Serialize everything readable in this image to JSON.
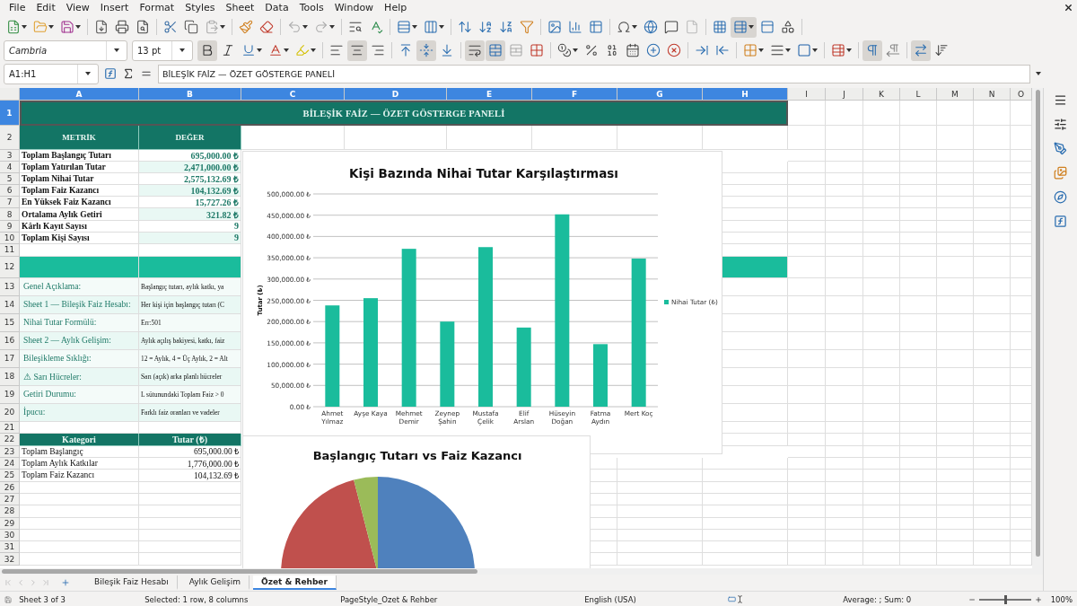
{
  "menu": [
    "File",
    "Edit",
    "View",
    "Insert",
    "Format",
    "Styles",
    "Sheet",
    "Data",
    "Tools",
    "Window",
    "Help"
  ],
  "standard_toolbar": [
    {
      "kind": "new",
      "dropdown": true,
      "on": false
    },
    {
      "kind": "open",
      "dropdown": true,
      "on": false
    },
    {
      "kind": "save",
      "dropdown": true,
      "on": false
    },
    {
      "kind": "pdf",
      "dropdown": false,
      "on": false
    },
    {
      "kind": "print",
      "dropdown": false,
      "on": false
    },
    {
      "kind": "preview",
      "dropdown": false,
      "on": false
    },
    {
      "kind": "cut",
      "dropdown": false,
      "on": false
    },
    {
      "kind": "copy",
      "dropdown": false,
      "on": false
    },
    {
      "kind": "paste",
      "dropdown": true,
      "on": false
    },
    {
      "kind": "clone",
      "dropdown": false,
      "on": false
    },
    {
      "kind": "clear",
      "dropdown": false,
      "on": false
    },
    {
      "kind": "undo",
      "dropdown": true,
      "on": false
    },
    {
      "kind": "redo",
      "dropdown": true,
      "on": false
    },
    {
      "kind": "find",
      "dropdown": false,
      "on": false
    },
    {
      "kind": "spelling",
      "dropdown": false,
      "on": false
    },
    {
      "kind": "row",
      "dropdown": true,
      "on": false
    },
    {
      "kind": "column",
      "dropdown": true,
      "on": false
    },
    {
      "kind": "sort",
      "dropdown": false,
      "on": false
    },
    {
      "kind": "sortasc",
      "dropdown": false,
      "on": false
    },
    {
      "kind": "sortdesc",
      "dropdown": false,
      "on": false
    },
    {
      "kind": "filter",
      "dropdown": false,
      "on": false
    },
    {
      "kind": "image",
      "dropdown": false,
      "on": false
    },
    {
      "kind": "chart",
      "dropdown": false,
      "on": false
    },
    {
      "kind": "pivot",
      "dropdown": false,
      "on": false
    },
    {
      "kind": "special",
      "dropdown": true,
      "on": false
    },
    {
      "kind": "link",
      "dropdown": false,
      "on": false
    },
    {
      "kind": "comment",
      "dropdown": false,
      "on": false
    },
    {
      "kind": "header",
      "dropdown": false,
      "on": false
    },
    {
      "kind": "printarea",
      "dropdown": false,
      "on": false
    },
    {
      "kind": "freeze",
      "dropdown": true,
      "on": true
    },
    {
      "kind": "split",
      "dropdown": false,
      "on": false
    },
    {
      "kind": "draw",
      "dropdown": false,
      "on": false
    }
  ],
  "formatting_toolbar": {
    "font_name": "Cambria",
    "font_size": "13 pt",
    "buttons": [
      {
        "kind": "bold",
        "dropdown": false,
        "on": true
      },
      {
        "kind": "italic",
        "dropdown": false,
        "on": false
      },
      {
        "kind": "underline",
        "dropdown": true,
        "on": false
      },
      {
        "kind": "fontcolor",
        "dropdown": true,
        "on": false
      },
      {
        "kind": "highlight",
        "dropdown": true,
        "on": false
      },
      {
        "kind": "left",
        "dropdown": false,
        "on": false
      },
      {
        "kind": "center",
        "dropdown": false,
        "on": true
      },
      {
        "kind": "right",
        "dropdown": false,
        "on": false
      },
      {
        "kind": "top",
        "dropdown": false,
        "on": false
      },
      {
        "kind": "middle",
        "dropdown": false,
        "on": true
      },
      {
        "kind": "bottom",
        "dropdown": false,
        "on": false
      },
      {
        "kind": "wrap",
        "dropdown": false,
        "on": true
      },
      {
        "kind": "merge",
        "dropdown": false,
        "on": true
      },
      {
        "kind": "unmerge",
        "dropdown": false,
        "on": false
      },
      {
        "kind": "mergecells",
        "dropdown": false,
        "on": false
      },
      {
        "kind": "currency",
        "dropdown": true,
        "on": false
      },
      {
        "kind": "percent",
        "dropdown": false,
        "on": false
      },
      {
        "kind": "number",
        "dropdown": false,
        "on": false
      },
      {
        "kind": "date",
        "dropdown": false,
        "on": false
      },
      {
        "kind": "adddecimal",
        "dropdown": false,
        "on": false
      },
      {
        "kind": "deldecimal",
        "dropdown": false,
        "on": false
      },
      {
        "kind": "indent",
        "dropdown": false,
        "on": false
      },
      {
        "kind": "outdent",
        "dropdown": false,
        "on": false
      },
      {
        "kind": "borders",
        "dropdown": true,
        "on": false
      },
      {
        "kind": "borderstyle",
        "dropdown": true,
        "on": false
      },
      {
        "kind": "bordercolor",
        "dropdown": true,
        "on": false
      },
      {
        "kind": "conditional",
        "dropdown": true,
        "on": false
      },
      {
        "kind": "ltr",
        "dropdown": false,
        "on": true
      },
      {
        "kind": "rtl",
        "dropdown": false,
        "on": false
      },
      {
        "kind": "textdir",
        "dropdown": false,
        "on": true
      },
      {
        "kind": "vertical",
        "dropdown": false,
        "on": false
      }
    ]
  },
  "formula_bar": {
    "name_box": "A1:H1",
    "content": "BİLEŞİK FAİZ — ÖZET GÖSTERGE PANELİ"
  },
  "column_headers": [
    {
      "label": "A",
      "selected": true
    },
    {
      "label": "B",
      "selected": true
    },
    {
      "label": "C",
      "selected": true
    },
    {
      "label": "D",
      "selected": true
    },
    {
      "label": "E",
      "selected": true
    },
    {
      "label": "F",
      "selected": true
    },
    {
      "label": "G",
      "selected": true
    },
    {
      "label": "H",
      "selected": true
    },
    {
      "label": "I",
      "selected": false
    },
    {
      "label": "J",
      "selected": false
    },
    {
      "label": "K",
      "selected": false
    },
    {
      "label": "L",
      "selected": false
    },
    {
      "label": "M",
      "selected": false
    },
    {
      "label": "N",
      "selected": false
    },
    {
      "label": "O",
      "selected": false
    }
  ],
  "row_headers": [
    {
      "label": "1",
      "selected": true
    },
    {
      "label": "2",
      "selected": false
    },
    {
      "label": "3",
      "selected": false
    },
    {
      "label": "4",
      "selected": false
    },
    {
      "label": "5",
      "selected": false
    },
    {
      "label": "6",
      "selected": false
    },
    {
      "label": "7",
      "selected": false
    },
    {
      "label": "8",
      "selected": false
    },
    {
      "label": "9",
      "selected": false
    },
    {
      "label": "10",
      "selected": false
    },
    {
      "label": "11",
      "selected": false
    },
    {
      "label": "12",
      "selected": false
    },
    {
      "label": "13",
      "selected": false
    },
    {
      "label": "14",
      "selected": false
    },
    {
      "label": "15",
      "selected": false
    },
    {
      "label": "16",
      "selected": false
    },
    {
      "label": "17",
      "selected": false
    },
    {
      "label": "18",
      "selected": false
    },
    {
      "label": "19",
      "selected": false
    },
    {
      "label": "20",
      "selected": false
    },
    {
      "label": "21",
      "selected": false
    },
    {
      "label": "22",
      "selected": false
    },
    {
      "label": "23",
      "selected": false
    },
    {
      "label": "24",
      "selected": false
    },
    {
      "label": "25",
      "selected": false
    },
    {
      "label": "26",
      "selected": false
    },
    {
      "label": "27",
      "selected": false
    },
    {
      "label": "28",
      "selected": false
    },
    {
      "label": "29",
      "selected": false
    },
    {
      "label": "30",
      "selected": false
    },
    {
      "label": "31",
      "selected": false
    },
    {
      "label": "32",
      "selected": false
    }
  ],
  "sheet": {
    "title": "BİLEŞİK FAİZ — ÖZET GÖSTERGE PANELİ",
    "metrics_columns": [
      "METRİK",
      "DEĞER"
    ],
    "metrics": [
      {
        "label": "Toplam Başlangıç Tutarı",
        "value": "695,000.00 ₺"
      },
      {
        "label": "Toplam Yatırılan Tutar",
        "value": "2,471,000.00 ₺"
      },
      {
        "label": "Toplam Nihai Tutar",
        "value": "2,575,132.69 ₺"
      },
      {
        "label": "Toplam Faiz Kazancı",
        "value": "104,132.69 ₺"
      },
      {
        "label": "En Yüksek Faiz Kazancı",
        "value": "15,727.26 ₺"
      },
      {
        "label": "Ortalama Aylık Getiri",
        "value": "321.82 ₺"
      },
      {
        "label": "Kârlı Kayıt Sayısı",
        "value": "9"
      },
      {
        "label": "Toplam Kişi Sayısı",
        "value": "9"
      }
    ],
    "notes": [
      {
        "label": "Genel Açıklama:",
        "text": "Başlangıç tutarı, aylık katkı, ya"
      },
      {
        "label": "Sheet 1 — Bileşik Faiz Hesabı:",
        "text": "Her kişi için başlangıç tutarı (C"
      },
      {
        "label": "Nihai Tutar Formülü:",
        "text": "Err:501"
      },
      {
        "label": "Sheet 2 — Aylık Gelişim:",
        "text": "Aylık açılış bakiyesi, katkı, faiz"
      },
      {
        "label": "Bileşikleme Sıklığı:",
        "text": "12 = Aylık, 4 = Üç Aylık, 2 = Alt"
      },
      {
        "label": "⚠ Sarı Hücreler:",
        "text": "Sarı (açık) arka planlı hücreler"
      },
      {
        "label": "Getiri Durumu:",
        "text": "L sütunundaki Toplam Faiz > 0"
      },
      {
        "label": "İpucu:",
        "text": "Farklı faiz oranları ve vadeler"
      }
    ],
    "summary_columns": [
      "Kategori",
      "Tutar (₺)"
    ],
    "summary": [
      {
        "label": "Toplam Başlangıç",
        "value": "695,000.00 ₺"
      },
      {
        "label": "Toplam Aylık Katkılar",
        "value": "1,776,000.00 ₺"
      },
      {
        "label": "Toplam Faiz Kazancı",
        "value": "104,132.69 ₺"
      }
    ]
  },
  "bar_chart": {
    "chart_data": {
      "type": "bar",
      "title": "Kişi Bazında Nihai Tutar Karşılaştırması",
      "ylabel": "Tutar (₺)",
      "categories": [
        "Ahmet Yılmaz",
        "Ayşe Kaya",
        "Mehmet Demir",
        "Zeynep Şahin",
        "Mustafa Çelik",
        "Elif Arslan",
        "Hüseyin Doğan",
        "Fatma Aydın",
        "Mert Koç"
      ],
      "series": [
        {
          "name": "Nihai Tutar (₺)",
          "color": "#1abc9c",
          "values": [
            238000,
            255000,
            371000,
            200000,
            375000,
            186000,
            452000,
            147000,
            348000
          ]
        }
      ],
      "ylim": [
        0,
        500000
      ],
      "grid": true,
      "yticks": [
        {
          "value": 0,
          "label": "0.00 ₺"
        },
        {
          "value": 50000,
          "label": "50,000.00 ₺"
        },
        {
          "value": 100000,
          "label": "100,000.00 ₺"
        },
        {
          "value": 150000,
          "label": "150,000.00 ₺"
        },
        {
          "value": 200000,
          "label": "200,000.00 ₺"
        },
        {
          "value": 250000,
          "label": "250,000.00 ₺"
        },
        {
          "value": 300000,
          "label": "300,000.00 ₺"
        },
        {
          "value": 350000,
          "label": "350,000.00 ₺"
        },
        {
          "value": 400000,
          "label": "400,000.00 ₺"
        },
        {
          "value": 450000,
          "label": "450,000.00 ₺"
        },
        {
          "value": 500000,
          "label": "500,000.00 ₺"
        }
      ]
    }
  },
  "pie_chart": {
    "title": "Başlangıç Tutarı vs Faiz Kazancı"
  },
  "sheet_tabs": [
    {
      "label": "Bileşik Faiz Hesabı",
      "selected": false
    },
    {
      "label": "Aylık Gelişim",
      "selected": false
    },
    {
      "label": "Özet & Rehber",
      "selected": true
    }
  ],
  "status_bar": {
    "sheet": "Sheet 3 of 3",
    "selection": "Selected: 1 row, 8 columns",
    "page_style": "PageStyle_Ozet & Rehber",
    "language": "English (USA)",
    "summary": "Average: ; Sum: 0",
    "zoom": "100%"
  },
  "zoom_slider": {
    "level": 0.5
  }
}
